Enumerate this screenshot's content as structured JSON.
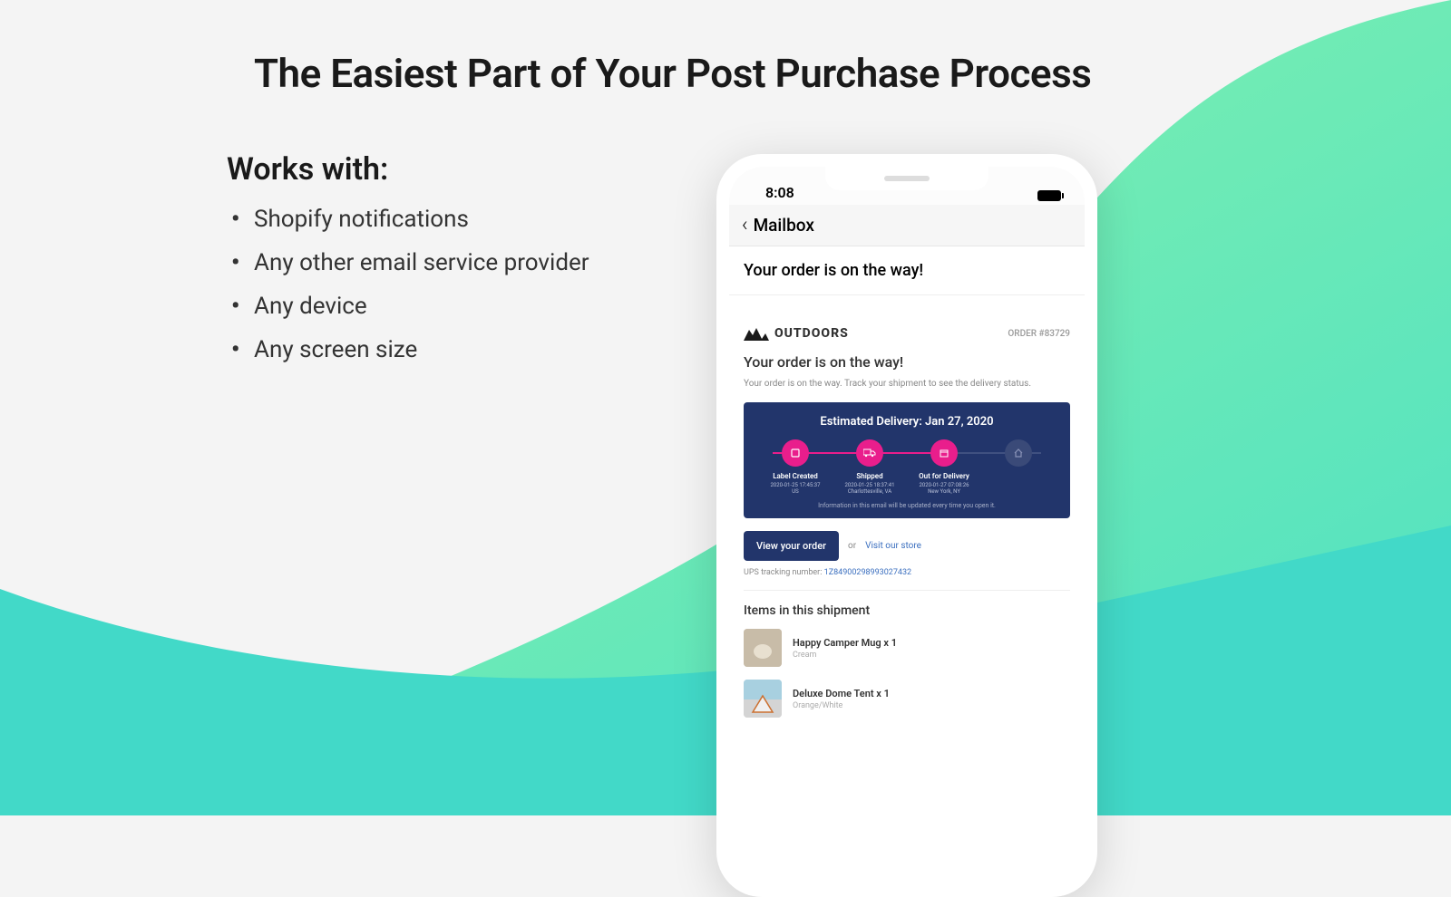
{
  "page": {
    "title": "The Easiest Part of Your Post Purchase Process",
    "subtitle": "Works with:",
    "bullets": [
      "Shopify notifications",
      "Any other email service provider",
      "Any device",
      "Any screen size"
    ]
  },
  "phone": {
    "time": "8:08",
    "nav_title": "Mailbox",
    "subject": "Your order is on the way!"
  },
  "email": {
    "brand": "OUTDOORS",
    "order_label": "ORDER #83729",
    "title": "Your order is on the way!",
    "desc": "Your order is on the way. Track your shipment to see the delivery status.",
    "tracking": {
      "est_label": "Estimated Delivery: Jan 27, 2020",
      "steps": [
        {
          "label": "Label Created",
          "time": "2020-01-25 17:45:37",
          "loc": "US",
          "active": true,
          "icon": "label"
        },
        {
          "label": "Shipped",
          "time": "2020-01-25 18:37:41",
          "loc": "Charlottesville, VA",
          "active": true,
          "icon": "truck"
        },
        {
          "label": "Out for Delivery",
          "time": "2020-01-27 07:08:26",
          "loc": "New York, NY",
          "active": true,
          "icon": "box"
        },
        {
          "label": "",
          "time": "",
          "loc": "",
          "active": false,
          "icon": "home"
        }
      ],
      "note": "Information in this email will be updated every time you open it."
    },
    "cta": {
      "primary": "View your order",
      "or": "or",
      "link": "Visit our store"
    },
    "tracking_label": "UPS tracking number: ",
    "tracking_number": "1Z84900298993027432",
    "items_title": "Items in this shipment",
    "items": [
      {
        "name": "Happy Camper Mug x 1",
        "variant": "Cream"
      },
      {
        "name": "Deluxe Dome Tent x 1",
        "variant": "Orange/White"
      }
    ]
  }
}
